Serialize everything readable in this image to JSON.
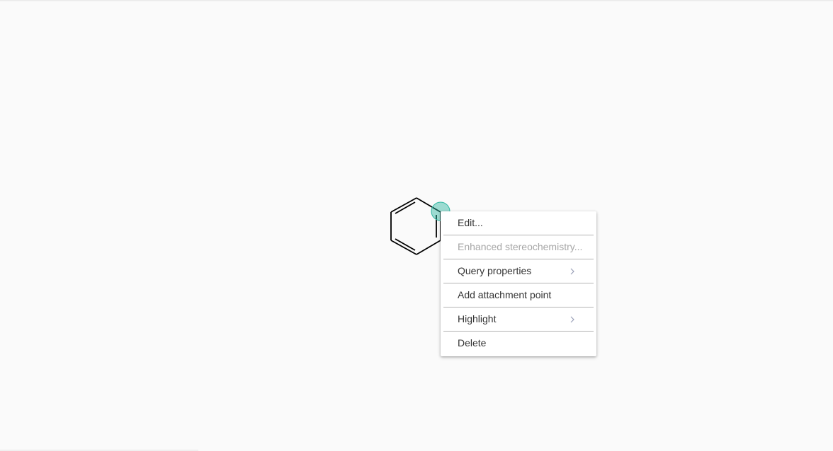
{
  "context_menu": {
    "items": [
      {
        "label": "Edit...",
        "enabled": true,
        "has_submenu": false
      },
      {
        "label": "Enhanced stereochemistry...",
        "enabled": false,
        "has_submenu": false
      },
      {
        "label": "Query properties",
        "enabled": true,
        "has_submenu": true
      },
      {
        "label": "Add attachment point",
        "enabled": true,
        "has_submenu": false
      },
      {
        "label": "Highlight",
        "enabled": true,
        "has_submenu": true
      },
      {
        "label": "Delete",
        "enabled": true,
        "has_submenu": false
      }
    ]
  },
  "molecule": {
    "name": "benzene-ring-structure",
    "selected_atom_highlight_color": "#2bb5a0",
    "bond_color": "#000000"
  },
  "colors": {
    "canvas_background": "#fafafa",
    "menu_text": "#333333",
    "menu_text_disabled": "#a6a6a6",
    "submenu_chevron": "#9aa0b8"
  }
}
